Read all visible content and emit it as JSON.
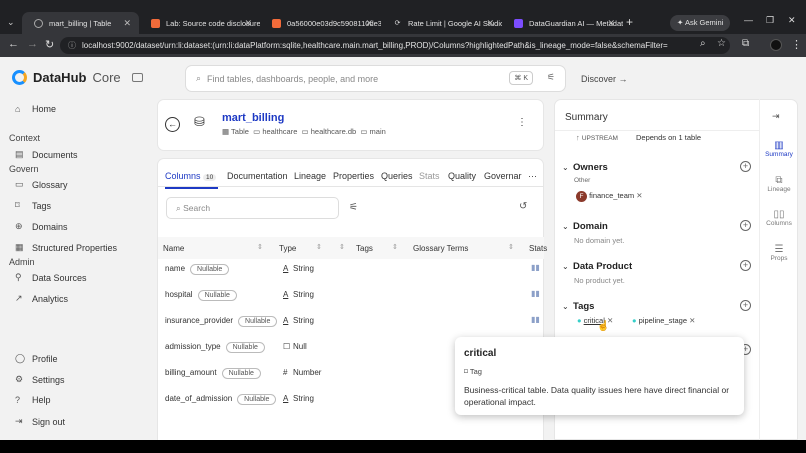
{
  "browser": {
    "tabs": [
      {
        "title": "mart_billing | Table",
        "active": true
      },
      {
        "title": "Lab: Source code disclosure v"
      },
      {
        "title": "0a56000e03d9c5908110de3e"
      },
      {
        "title": "Rate Limit | Google AI Studio"
      },
      {
        "title": "DataGuardian AI — Metadat"
      }
    ],
    "new_tab": "+",
    "ask_gemini": "Ask Gemini",
    "url": "localhost:9002/dataset/urn:li:dataset:(urn:li:dataPlatform:sqlite,healthcare.main.mart_billing,PROD)/Columns?highlightedPath&is_lineage_mode=false&schemaFilter="
  },
  "sidebar": {
    "brand": "DataHub",
    "edition": "Core",
    "home": "Home",
    "context_label": "Context",
    "documents": "Documents",
    "govern_label": "Govern",
    "glossary": "Glossary",
    "tags": "Tags",
    "domains": "Domains",
    "structured_properties": "Structured Properties",
    "admin_label": "Admin",
    "data_sources": "Data Sources",
    "analytics": "Analytics",
    "profile": "Profile",
    "settings": "Settings",
    "help": "Help",
    "sign_out": "Sign out"
  },
  "search": {
    "placeholder": "Find tables, dashboards, people, and more",
    "shortcut": "⌘ K"
  },
  "discover": "Discover →",
  "entity": {
    "name": "mart_billing",
    "type": "Table",
    "path": [
      "healthcare",
      "healthcare.db",
      "main"
    ]
  },
  "tabs": [
    {
      "label": "Columns",
      "count": "10"
    },
    {
      "label": "Documentation"
    },
    {
      "label": "Lineage"
    },
    {
      "label": "Properties"
    },
    {
      "label": "Queries"
    },
    {
      "label": "Stats"
    },
    {
      "label": "Quality"
    },
    {
      "label": "Governar"
    }
  ],
  "column_search": "Search",
  "columns_header": [
    "Name",
    "Type",
    "Tags",
    "Glossary Terms",
    "Stats"
  ],
  "columns": [
    {
      "name": "name",
      "nullable": "Nullable",
      "type": "String",
      "type_icon": "A"
    },
    {
      "name": "hospital",
      "nullable": "Nullable",
      "type": "String",
      "type_icon": "A"
    },
    {
      "name": "insurance_provider",
      "nullable": "Nullable",
      "type": "String",
      "type_icon": "A"
    },
    {
      "name": "admission_type",
      "nullable": "Nullable",
      "type": "Null",
      "type_icon": "☐"
    },
    {
      "name": "billing_amount",
      "nullable": "Nullable",
      "type": "Number",
      "type_icon": "#"
    },
    {
      "name": "date_of_admission",
      "nullable": "Nullable",
      "type": "String",
      "type_icon": "A"
    }
  ],
  "summary": {
    "title": "Summary",
    "upstream_label": "UPSTREAM",
    "upstream_value": "Depends on 1 table",
    "owners": "Owners",
    "owners_type": "Other",
    "owner": "finance_team",
    "owner_initial": "F",
    "domain": "Domain",
    "domain_empty": "No domain yet.",
    "data_product": "Data Product",
    "data_product_empty": "No product yet.",
    "tags": "Tags",
    "tag_list": [
      "critical",
      "pipeline_stage"
    ]
  },
  "right_rail": [
    "Summary",
    "Lineage",
    "Columns",
    "Props"
  ],
  "popup": {
    "title": "critical",
    "kind": "Tag",
    "description": "Business-critical table. Data quality issues here have direct financial or operational impact."
  },
  "colors": {
    "accent": "#1890ff",
    "tag_dot": "#36cfc9",
    "owner_badge": "#8b3a2b"
  }
}
